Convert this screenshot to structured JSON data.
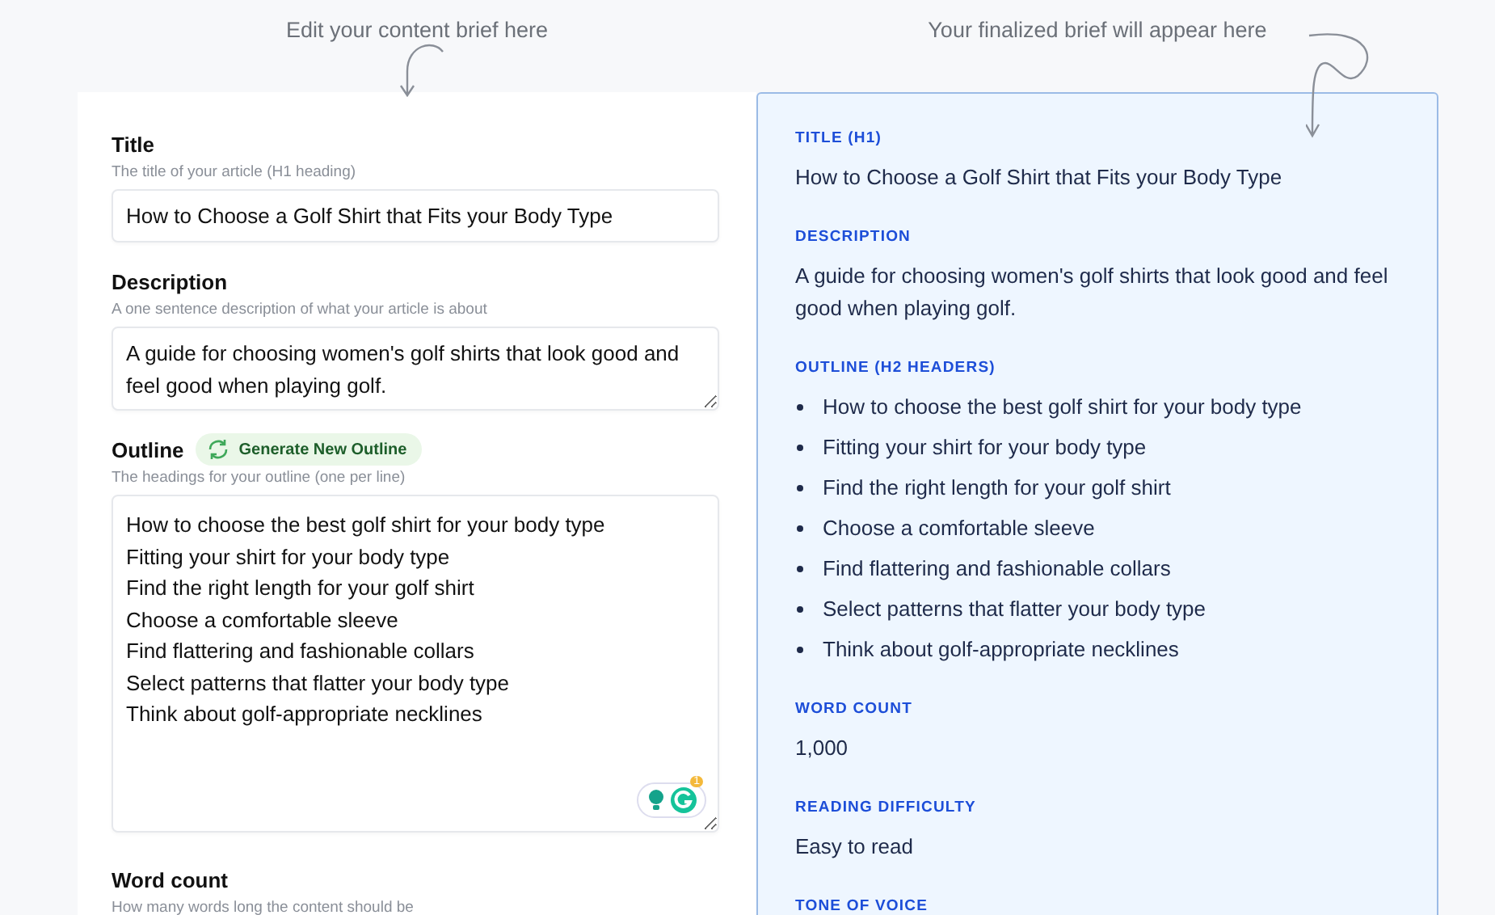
{
  "annotations": {
    "editor": "Edit your content brief here",
    "preview": "Your finalized brief will appear here"
  },
  "editor": {
    "fields": [
      {
        "kind": "input",
        "label": "Title",
        "hint": "The title of your article (H1 heading)",
        "value": "How to Choose a Golf Shirt that Fits your Body Type"
      },
      {
        "kind": "textarea",
        "label": "Description",
        "hint": "A one sentence description of what your article is about",
        "value": "A guide for choosing women's golf shirts that look good and feel good when playing golf."
      },
      {
        "kind": "outline",
        "label": "Outline",
        "button": "Generate New Outline",
        "hint": "The headings for your outline (one per line)",
        "lines": [
          "How to choose the best golf shirt for your body type",
          "Fitting your shirt for your body type",
          "Find the right length for your golf shirt",
          "Choose a comfortable sleeve",
          "Find flattering and fashionable collars",
          "Select patterns that flatter your body type",
          "Think about golf-appropriate necklines"
        ],
        "assistant_badge": "1"
      },
      {
        "kind": "label",
        "label": "Word count",
        "hint": "How many words long the content should be"
      }
    ]
  },
  "preview": {
    "sections": [
      {
        "kind": "text",
        "heading": "TITLE (H1)",
        "value": "How to Choose a Golf Shirt that Fits your Body Type"
      },
      {
        "kind": "text",
        "heading": "DESCRIPTION",
        "value": "A guide for choosing women's golf shirts that look good and feel good when playing golf."
      },
      {
        "kind": "list",
        "heading": "OUTLINE (H2 HEADERS)",
        "items": [
          "How to choose the best golf shirt for your body type",
          "Fitting your shirt for your body type",
          "Find the right length for your golf shirt",
          "Choose a comfortable sleeve",
          "Find flattering and fashionable collars",
          "Select patterns that flatter your body type",
          "Think about golf-appropriate necklines"
        ]
      },
      {
        "kind": "text",
        "heading": "WORD COUNT",
        "value": "1,000"
      },
      {
        "kind": "text",
        "heading": "READING DIFFICULTY",
        "value": "Easy to read"
      },
      {
        "kind": "heading",
        "heading": "TONE OF VOICE"
      }
    ]
  }
}
